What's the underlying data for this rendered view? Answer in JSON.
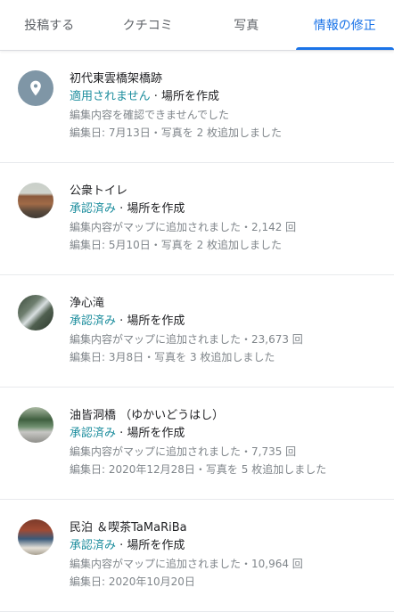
{
  "tabs": [
    {
      "label": "投稿する",
      "active": false
    },
    {
      "label": "クチコミ",
      "active": false
    },
    {
      "label": "写真",
      "active": false
    },
    {
      "label": "情報の修正",
      "active": true
    }
  ],
  "colors": {
    "accent": "#1a73e8",
    "status": "#1e8e9e",
    "secondary_text": "#80868b"
  },
  "items": [
    {
      "thumb": "location-pin-icon",
      "name": "初代東雲橋架橋跡",
      "state": "適用されません",
      "sep": " · ",
      "action": "場所を作成",
      "line1": "編集内容を確認できませんでした",
      "line2": "編集日: 7月13日・写真を 2 枚追加しました"
    },
    {
      "thumb": "place-photo",
      "name": "公衆トイレ",
      "state": "承認済み",
      "sep": " · ",
      "action": "場所を作成",
      "line1": "編集内容がマップに追加されました・2,142 回",
      "line2": "編集日: 5月10日・写真を 2 枚追加しました"
    },
    {
      "thumb": "place-photo",
      "name": "浄心滝",
      "state": "承認済み",
      "sep": " · ",
      "action": "場所を作成",
      "line1": "編集内容がマップに追加されました・23,673 回",
      "line2": "編集日: 3月8日・写真を 3 枚追加しました"
    },
    {
      "thumb": "place-photo",
      "name": "油皆洞橋 （ゆかいどうはし）",
      "state": "承認済み",
      "sep": " · ",
      "action": "場所を作成",
      "line1": "編集内容がマップに追加されました・7,735 回",
      "line2": "編集日: 2020年12月28日・写真を 5 枚追加しました"
    },
    {
      "thumb": "place-photo",
      "name": "民泊 ＆喫茶TaMaRiBa",
      "state": "承認済み",
      "sep": " · ",
      "action": "場所を作成",
      "line1": "編集内容がマップに追加されました・10,964 回",
      "line2": "編集日: 2020年10月20日"
    }
  ]
}
